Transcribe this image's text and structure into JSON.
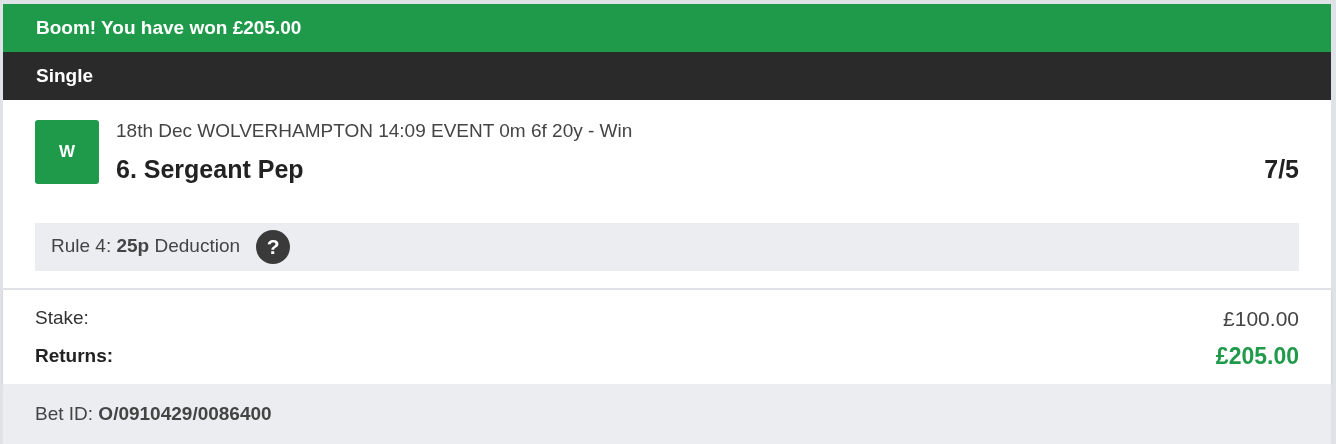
{
  "win_banner": "Boom! You have won £205.00",
  "bet_type": "Single",
  "selection": {
    "result_badge": "W",
    "event": "18th Dec WOLVERHAMPTON 14:09 EVENT 0m 6f 20y - Win",
    "name": "6. Sergeant Pep",
    "odds": "7/5"
  },
  "rule_notice": {
    "text": "Rule 4: **25p** Deduction",
    "help": "?"
  },
  "summary": [
    {
      "label": "Stake:",
      "value": "£100.00",
      "kind": "plain"
    },
    {
      "label": "Returns:",
      "value": "£205.00",
      "kind": "highlight"
    }
  ],
  "bet_id": "Bet ID: **O/0910429/0086400**"
}
